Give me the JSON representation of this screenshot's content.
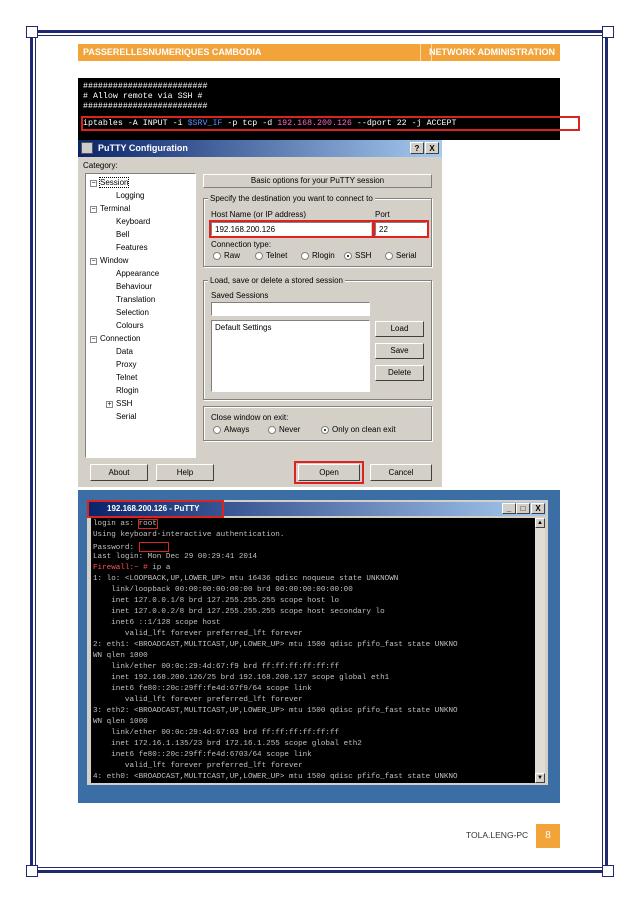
{
  "header": {
    "left": "PASSERELLESNUMERIQUES CAMBODIA",
    "right": "NETWORK ADMINISTRATION"
  },
  "terminal1": {
    "lines": [
      "#########################",
      "# Allow remote via SSH #",
      "#########################"
    ],
    "cmd_prefix": "iptables -A INPUT -i ",
    "cmd_var": "$SRV_IF",
    "cmd_mid": " -p tcp -d ",
    "cmd_ip": "192.168.200.126",
    "cmd_suffix": " --dport 22 -j ACCEPT"
  },
  "putty_config": {
    "title": "PuTTY Configuration",
    "help_btn": "?",
    "close_btn": "X",
    "category_label": "Category:",
    "tree": [
      {
        "label": "Session",
        "level": 0,
        "toggle": "−"
      },
      {
        "label": "Logging",
        "level": 1
      },
      {
        "label": "Terminal",
        "level": 0,
        "toggle": "−"
      },
      {
        "label": "Keyboard",
        "level": 1
      },
      {
        "label": "Bell",
        "level": 1
      },
      {
        "label": "Features",
        "level": 1
      },
      {
        "label": "Window",
        "level": 0,
        "toggle": "−"
      },
      {
        "label": "Appearance",
        "level": 1
      },
      {
        "label": "Behaviour",
        "level": 1
      },
      {
        "label": "Translation",
        "level": 1
      },
      {
        "label": "Selection",
        "level": 1
      },
      {
        "label": "Colours",
        "level": 1
      },
      {
        "label": "Connection",
        "level": 0,
        "toggle": "−"
      },
      {
        "label": "Data",
        "level": 1
      },
      {
        "label": "Proxy",
        "level": 1
      },
      {
        "label": "Telnet",
        "level": 1
      },
      {
        "label": "Rlogin",
        "level": 1
      },
      {
        "label": "SSH",
        "level": 1,
        "toggle": "+"
      },
      {
        "label": "Serial",
        "level": 1
      }
    ],
    "panel_title": "Basic options for your PuTTY session",
    "dest_label": "Specify the destination you want to connect to",
    "host_label": "Host Name (or IP address)",
    "port_label": "Port",
    "host_value": "192.168.200.126",
    "port_value": "22",
    "conn_type_label": "Connection type:",
    "conn_types": [
      "Raw",
      "Telnet",
      "Rlogin",
      "SSH",
      "Serial"
    ],
    "conn_selected": "SSH",
    "session_group": "Load, save or delete a stored session",
    "saved_label": "Saved Sessions",
    "saved_value": "",
    "sessions": [
      "Default Settings"
    ],
    "load_btn": "Load",
    "save_btn": "Save",
    "delete_btn": "Delete",
    "close_label": "Close window on exit:",
    "close_opts": [
      "Always",
      "Never",
      "Only on clean exit"
    ],
    "close_selected": "Only on clean exit",
    "about_btn": "About",
    "help_text_btn": "Help",
    "open_btn": "Open",
    "cancel_btn": "Cancel"
  },
  "putty_term": {
    "title": "192.168.200.126 - PuTTY",
    "min_btn": "_",
    "max_btn": "□",
    "close_btn": "X",
    "login_prefix": "login as: ",
    "login_user": "root",
    "password_prefix": "Password: ",
    "prompt": "Firewall:~ #",
    "prompt_cmd": " ip a",
    "lines": [
      "Using keyboard-interactive authentication.",
      "Last login: Mon Dec 29 00:29:41 2014",
      "1: lo: <LOOPBACK,UP,LOWER_UP> mtu 16436 qdisc noqueue state UNKNOWN",
      "    link/loopback 00:00:00:00:00:00 brd 00:00:00:00:00:00",
      "    inet 127.0.0.1/8 brd 127.255.255.255 scope host lo",
      "    inet 127.0.0.2/8 brd 127.255.255.255 scope host secondary lo",
      "    inet6 ::1/128 scope host",
      "       valid_lft forever preferred_lft forever",
      "2: eth1: <BROADCAST,MULTICAST,UP,LOWER_UP> mtu 1500 qdisc pfifo_fast state UNKNO",
      "WN qlen 1000",
      "    link/ether 00:0c:29:4d:67:f9 brd ff:ff:ff:ff:ff:ff",
      "    inet 192.168.200.126/25 brd 192.168.200.127 scope global eth1",
      "    inet6 fe80::20c:29ff:fe4d:67f9/64 scope link",
      "       valid_lft forever preferred_lft forever",
      "3: eth2: <BROADCAST,MULTICAST,UP,LOWER_UP> mtu 1500 qdisc pfifo_fast state UNKNO",
      "WN qlen 1000",
      "    link/ether 00:0c:29:4d:67:03 brd ff:ff:ff:ff:ff:ff",
      "    inet 172.16.1.135/23 brd 172.16.1.255 scope global eth2",
      "    inet6 fe80::20c:29ff:fe4d:6703/64 scope link",
      "       valid_lft forever preferred_lft forever",
      "4: eth0: <BROADCAST,MULTICAST,UP,LOWER_UP> mtu 1500 qdisc pfifo_fast state UNKNO"
    ]
  },
  "footer": {
    "author": "TOLA.LENG-PC",
    "page": "8"
  },
  "colors": {
    "accent": "#f2a33a",
    "frame": "#1f2a6e",
    "highlight": "#dd2222"
  }
}
